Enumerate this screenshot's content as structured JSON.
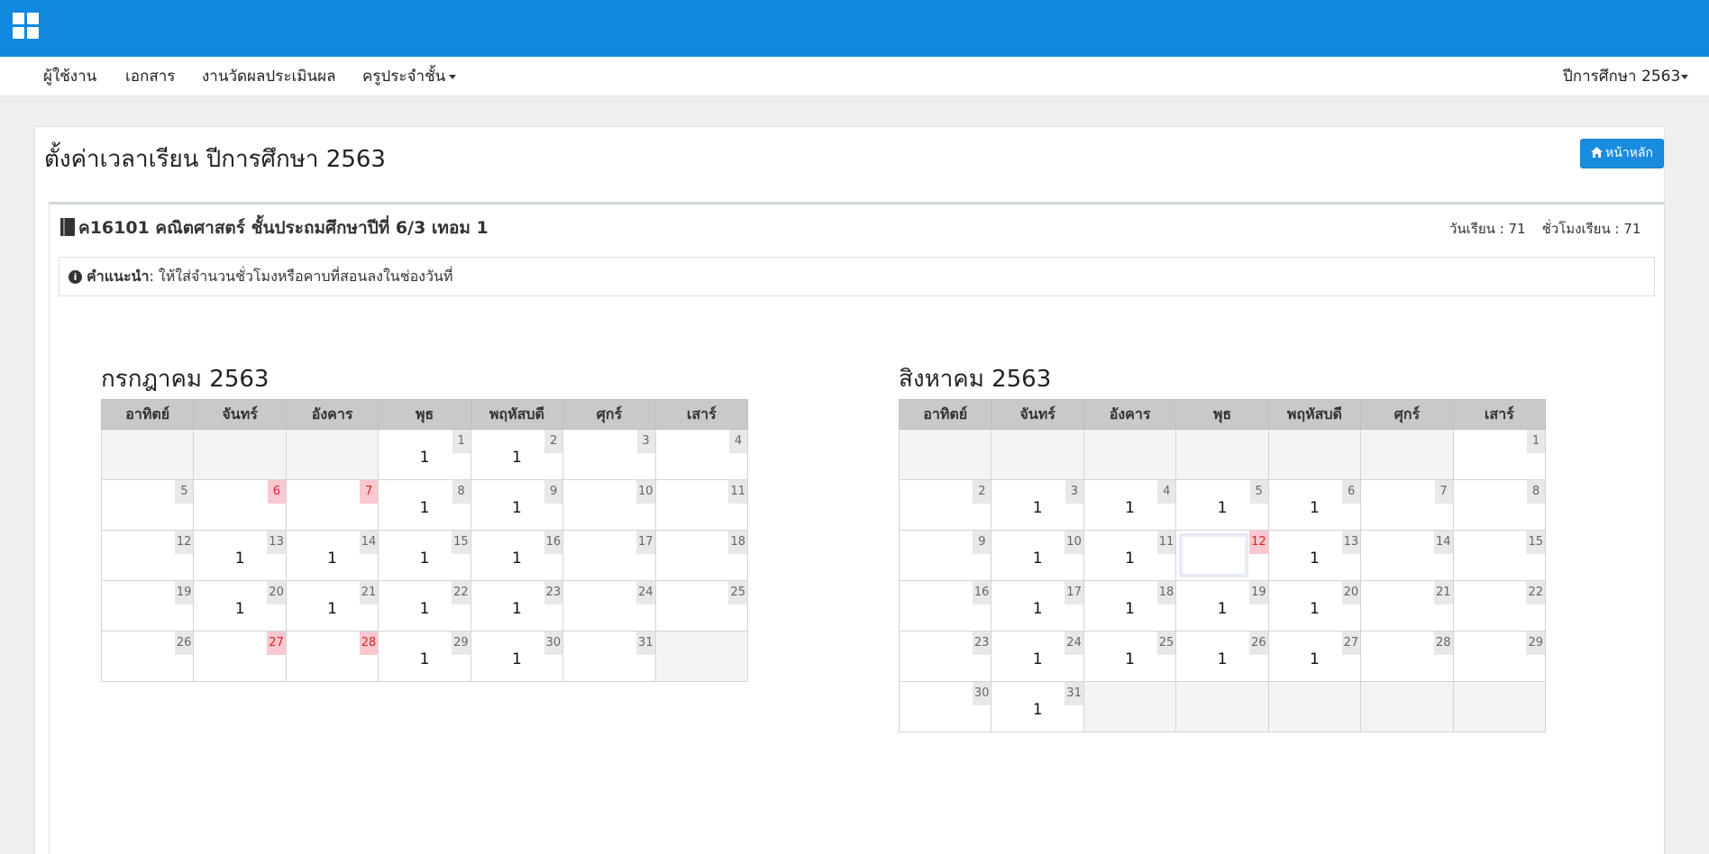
{
  "nav": {
    "items": [
      "ผู้ใช้งาน",
      "เอกสาร",
      "งานวัดผลประเมินผล",
      "ครูประจำชั้น"
    ],
    "year_menu": "ปีการศึกษา 2563"
  },
  "page": {
    "title": "ตั้งค่าเวลาเรียน ปีการศึกษา 2563",
    "home_button": "หน้าหลัก"
  },
  "course": {
    "title": "ค16101 คณิตศาสตร์ ชั้นประถมศึกษาปีที่ 6/3 เทอม 1",
    "days_label": "วันเรียน : 71",
    "hours_label": "ชั่วโมงเรียน : 71"
  },
  "tip": {
    "label": "คำแนะนำ",
    "text": ": ให้ใส่จำนวนชั่วโมงหรือคาบที่สอนลงในช่องวันที่"
  },
  "weekdays": [
    "อาทิตย์",
    "จันทร์",
    "อังคาร",
    "พุธ",
    "พฤหัสบดี",
    "ศุกร์",
    "เสาร์"
  ],
  "calendars": [
    {
      "title": "กรกฎาคม 2563",
      "weeks": [
        [
          null,
          null,
          null,
          {
            "d": "1",
            "v": "1"
          },
          {
            "d": "2",
            "v": "1"
          },
          {
            "d": "3",
            "v": ""
          },
          {
            "d": "4",
            "v": ""
          }
        ],
        [
          {
            "d": "5",
            "v": ""
          },
          {
            "d": "6",
            "v": "",
            "h": true
          },
          {
            "d": "7",
            "v": "",
            "h": true
          },
          {
            "d": "8",
            "v": "1"
          },
          {
            "d": "9",
            "v": "1"
          },
          {
            "d": "10",
            "v": ""
          },
          {
            "d": "11",
            "v": ""
          }
        ],
        [
          {
            "d": "12",
            "v": ""
          },
          {
            "d": "13",
            "v": "1"
          },
          {
            "d": "14",
            "v": "1"
          },
          {
            "d": "15",
            "v": "1"
          },
          {
            "d": "16",
            "v": "1"
          },
          {
            "d": "17",
            "v": ""
          },
          {
            "d": "18",
            "v": ""
          }
        ],
        [
          {
            "d": "19",
            "v": ""
          },
          {
            "d": "20",
            "v": "1"
          },
          {
            "d": "21",
            "v": "1"
          },
          {
            "d": "22",
            "v": "1"
          },
          {
            "d": "23",
            "v": "1"
          },
          {
            "d": "24",
            "v": ""
          },
          {
            "d": "25",
            "v": ""
          }
        ],
        [
          {
            "d": "26",
            "v": ""
          },
          {
            "d": "27",
            "v": "",
            "h": true
          },
          {
            "d": "28",
            "v": "",
            "h": true
          },
          {
            "d": "29",
            "v": "1"
          },
          {
            "d": "30",
            "v": "1"
          },
          {
            "d": "31",
            "v": ""
          },
          null
        ]
      ]
    },
    {
      "title": "สิงหาคม 2563",
      "weeks": [
        [
          null,
          null,
          null,
          null,
          null,
          null,
          {
            "d": "1",
            "v": ""
          }
        ],
        [
          {
            "d": "2",
            "v": ""
          },
          {
            "d": "3",
            "v": "1"
          },
          {
            "d": "4",
            "v": "1"
          },
          {
            "d": "5",
            "v": "1"
          },
          {
            "d": "6",
            "v": "1"
          },
          {
            "d": "7",
            "v": ""
          },
          {
            "d": "8",
            "v": ""
          }
        ],
        [
          {
            "d": "9",
            "v": ""
          },
          {
            "d": "10",
            "v": "1"
          },
          {
            "d": "11",
            "v": "1"
          },
          {
            "d": "12",
            "v": "",
            "h": true,
            "sel": true
          },
          {
            "d": "13",
            "v": "1"
          },
          {
            "d": "14",
            "v": ""
          },
          {
            "d": "15",
            "v": ""
          }
        ],
        [
          {
            "d": "16",
            "v": ""
          },
          {
            "d": "17",
            "v": "1"
          },
          {
            "d": "18",
            "v": "1"
          },
          {
            "d": "19",
            "v": "1"
          },
          {
            "d": "20",
            "v": "1"
          },
          {
            "d": "21",
            "v": ""
          },
          {
            "d": "22",
            "v": ""
          }
        ],
        [
          {
            "d": "23",
            "v": ""
          },
          {
            "d": "24",
            "v": "1"
          },
          {
            "d": "25",
            "v": "1"
          },
          {
            "d": "26",
            "v": "1"
          },
          {
            "d": "27",
            "v": "1"
          },
          {
            "d": "28",
            "v": ""
          },
          {
            "d": "29",
            "v": ""
          }
        ],
        [
          {
            "d": "30",
            "v": ""
          },
          {
            "d": "31",
            "v": "1"
          },
          null,
          null,
          null,
          null,
          null
        ]
      ]
    }
  ],
  "colors": {
    "topbar": "#1089de",
    "button": "#1a8ce0",
    "holiday_badge": "#f9c8d1",
    "holiday_text": "#dd2222",
    "header_row": "#c9c9c9"
  }
}
